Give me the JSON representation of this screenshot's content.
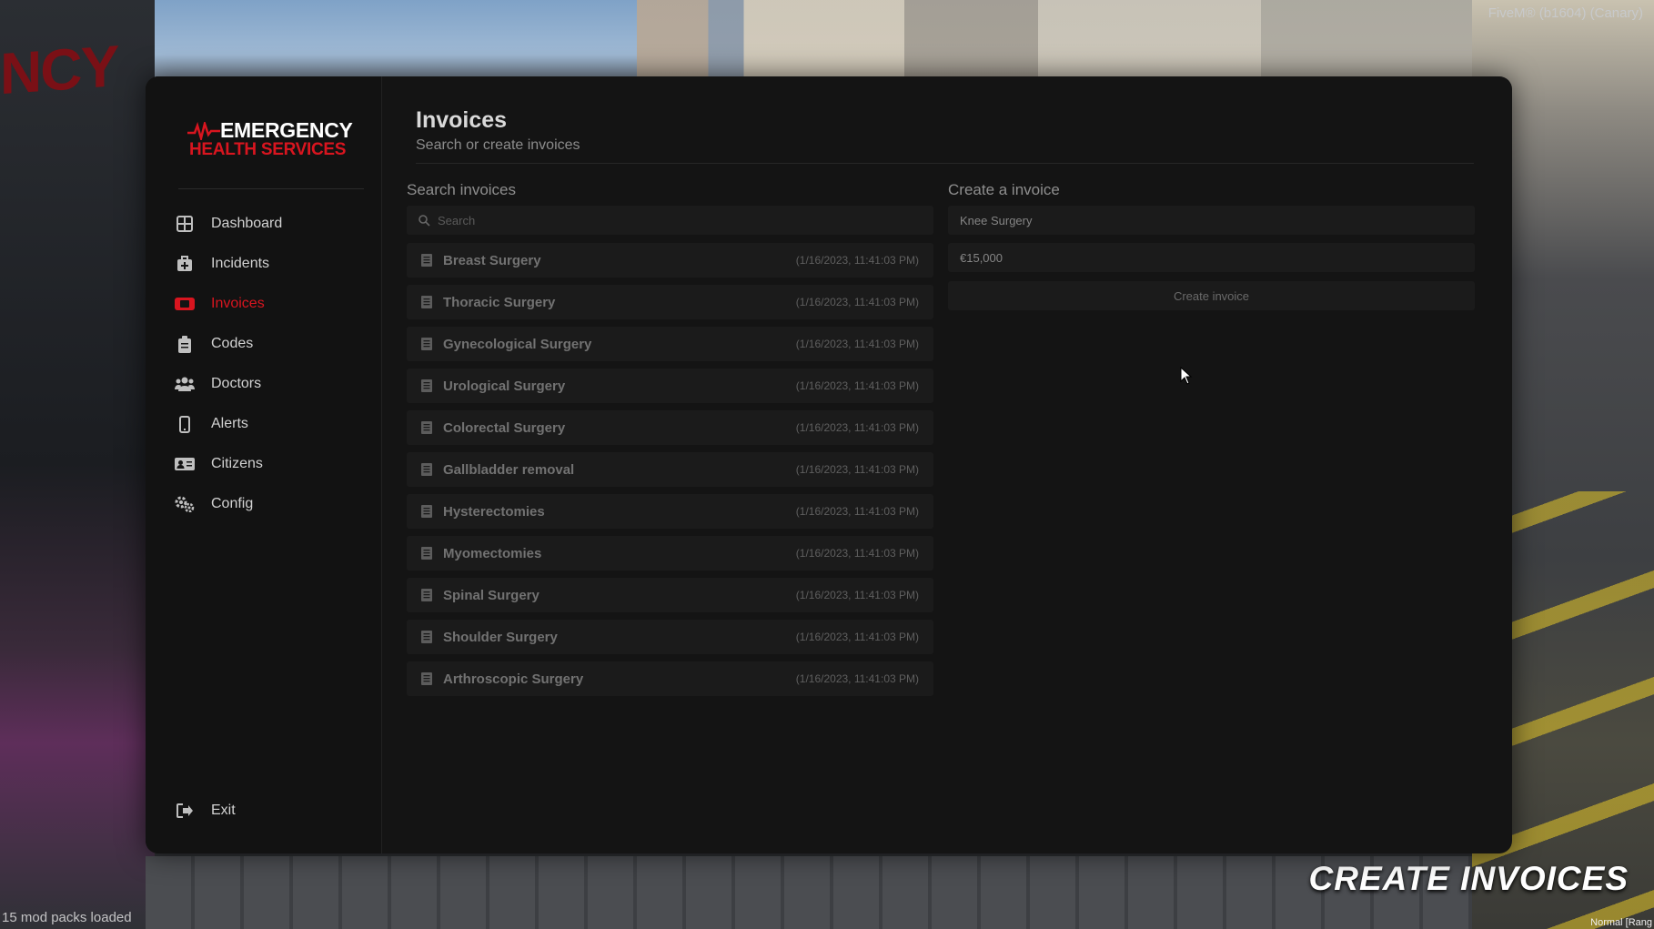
{
  "overlay": {
    "fivem": "FiveM® (b1604) (Canary)",
    "mods": "15 mod packs loaded",
    "normal": "Normal [Rang",
    "caption": "CREATE INVOICES",
    "left_sign": "NCY"
  },
  "brand": {
    "line1": "EMERGENCY",
    "line2": "HEALTH SERVICES",
    "accent": "#d8151f"
  },
  "sidebar": {
    "items": [
      {
        "label": "Dashboard",
        "icon": "grid-icon"
      },
      {
        "label": "Incidents",
        "icon": "medkit-icon"
      },
      {
        "label": "Invoices",
        "icon": "ticket-icon",
        "active": true
      },
      {
        "label": "Codes",
        "icon": "clipboard-icon"
      },
      {
        "label": "Doctors",
        "icon": "users-icon"
      },
      {
        "label": "Alerts",
        "icon": "phone-icon"
      },
      {
        "label": "Citizens",
        "icon": "id-card-icon"
      },
      {
        "label": "Config",
        "icon": "gears-icon"
      }
    ],
    "exit": {
      "label": "Exit",
      "icon": "exit-icon"
    }
  },
  "header": {
    "title": "Invoices",
    "subtitle": "Search or create invoices"
  },
  "search": {
    "title": "Search invoices",
    "placeholder": "Search",
    "results": [
      {
        "name": "Breast Surgery",
        "date": "(1/16/2023, 11:41:03 PM)"
      },
      {
        "name": "Thoracic Surgery",
        "date": "(1/16/2023, 11:41:03 PM)"
      },
      {
        "name": "Gynecological Surgery",
        "date": "(1/16/2023, 11:41:03 PM)"
      },
      {
        "name": "Urological Surgery",
        "date": "(1/16/2023, 11:41:03 PM)"
      },
      {
        "name": "Colorectal Surgery",
        "date": "(1/16/2023, 11:41:03 PM)"
      },
      {
        "name": "Gallbladder removal",
        "date": "(1/16/2023, 11:41:03 PM)"
      },
      {
        "name": "Hysterectomies",
        "date": "(1/16/2023, 11:41:03 PM)"
      },
      {
        "name": "Myomectomies",
        "date": "(1/16/2023, 11:41:03 PM)"
      },
      {
        "name": "Spinal Surgery",
        "date": "(1/16/2023, 11:41:03 PM)"
      },
      {
        "name": "Shoulder Surgery",
        "date": "(1/16/2023, 11:41:03 PM)"
      },
      {
        "name": "Arthroscopic Surgery",
        "date": "(1/16/2023, 11:41:03 PM)"
      }
    ]
  },
  "create": {
    "title": "Create a invoice",
    "name_value": "Knee Surgery",
    "amount_value": "€15,000",
    "button_label": "Create invoice"
  }
}
